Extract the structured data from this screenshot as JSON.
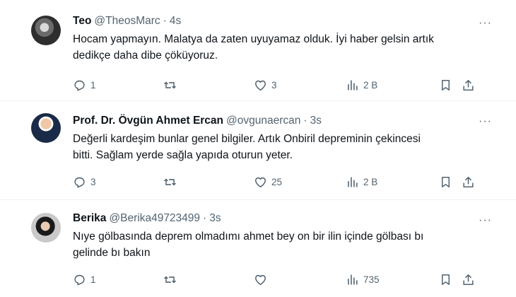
{
  "tweets": [
    {
      "name": "Teo",
      "handle": "@TheosMarc",
      "separator": "·",
      "time": "4s",
      "text_lines": [
        "Hocam yapmayın. Malatya da zaten uyuyamaz olduk. İyi haber gelsin artık",
        "dedikçe daha dibe çöküyoruz."
      ],
      "replies": "1",
      "retweets": "",
      "likes": "3",
      "views": "2 B"
    },
    {
      "name": "Prof. Dr. Övgün Ahmet Ercan",
      "handle": "@ovgunaercan",
      "separator": "·",
      "time": "3s",
      "text_lines": [
        "Değerli kardeşim bunlar genel bilgiler. Artık Onbiril depreminin çekincesi",
        "bitti. Sağlam yerde sağla yapıda oturun yeter."
      ],
      "replies": "3",
      "retweets": "",
      "likes": "25",
      "views": "2 B"
    },
    {
      "name": "Berika",
      "handle": "@Berika49723499",
      "separator": "·",
      "time": "3s",
      "text_lines": [
        "Nıye gölbasında deprem olmadımı ahmet bey on bir ilin içinde gölbası bı",
        "gelinde bı bakın"
      ],
      "replies": "1",
      "retweets": "",
      "likes": "",
      "views": "735"
    }
  ],
  "icons": {
    "reply": "reply-icon",
    "retweet": "retweet-icon",
    "like": "heart-icon",
    "views": "views-chart-icon",
    "bookmark": "bookmark-icon",
    "share": "share-icon",
    "more": "more-dots-icon"
  },
  "colors": {
    "text": "#0f1419",
    "secondary": "#536471",
    "divider": "#eff3f4"
  }
}
